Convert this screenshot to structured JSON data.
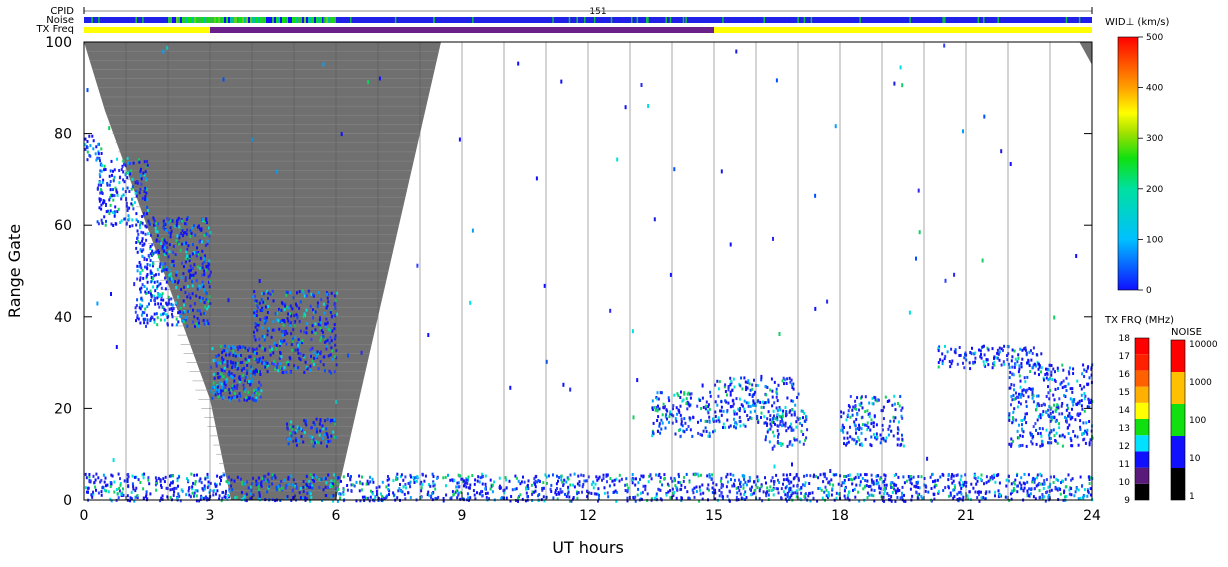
{
  "header": {
    "cpid_label": "CPID",
    "noise_label": "Noise",
    "txfreq_label": "TX Freq",
    "cpid_value": "151"
  },
  "chart_data": {
    "type": "heatmap",
    "title": "",
    "xlabel": "UT hours",
    "ylabel": "Range Gate",
    "xlim": [
      0,
      24
    ],
    "ylim": [
      0,
      100
    ],
    "x_ticks": [
      "0",
      "3",
      "6",
      "9",
      "12",
      "15",
      "18",
      "21",
      "24"
    ],
    "y_ticks": [
      "0",
      "20",
      "40",
      "60",
      "80",
      "100"
    ],
    "ground_scatter": {
      "color": "#707070",
      "boundary": [
        [
          0.0,
          100
        ],
        [
          0.5,
          85
        ],
        [
          3.0,
          22
        ],
        [
          3.5,
          0
        ],
        [
          6.0,
          0
        ],
        [
          8.5,
          100
        ]
      ],
      "end_wedge": [
        [
          24.0,
          100
        ],
        [
          23.7,
          100
        ],
        [
          24.0,
          95
        ]
      ]
    },
    "tx_freq_strip": {
      "segments": [
        {
          "from": 0,
          "to": 3,
          "color": "#ffff00"
        },
        {
          "from": 3,
          "to": 15,
          "color": "#6a1f8a"
        },
        {
          "from": 15,
          "to": 24,
          "color": "#ffff00"
        }
      ]
    },
    "noise_strip": {
      "base_color": "#2020e6",
      "green_band": [
        2.0,
        6.0
      ]
    },
    "echo_regions": [
      {
        "x": [
          0.0,
          24.0
        ],
        "y": [
          0,
          6
        ],
        "density": 0.55
      },
      {
        "x": [
          0.0,
          0.4
        ],
        "y": [
          74,
          80
        ],
        "density": 0.5
      },
      {
        "x": [
          0.3,
          1.5
        ],
        "y": [
          60,
          75
        ],
        "density": 0.5
      },
      {
        "x": [
          1.2,
          3.0
        ],
        "y": [
          38,
          62
        ],
        "density": 0.55
      },
      {
        "x": [
          3.0,
          4.2
        ],
        "y": [
          22,
          34
        ],
        "density": 0.7
      },
      {
        "x": [
          4.0,
          6.0
        ],
        "y": [
          28,
          46
        ],
        "density": 0.45
      },
      {
        "x": [
          4.8,
          6.0
        ],
        "y": [
          12,
          18
        ],
        "density": 0.5
      },
      {
        "x": [
          13.5,
          15.0
        ],
        "y": [
          14,
          24
        ],
        "density": 0.45
      },
      {
        "x": [
          15.0,
          17.0
        ],
        "y": [
          16,
          27
        ],
        "density": 0.45
      },
      {
        "x": [
          16.2,
          17.2
        ],
        "y": [
          12,
          20
        ],
        "density": 0.5
      },
      {
        "x": [
          18.0,
          19.5
        ],
        "y": [
          12,
          23
        ],
        "density": 0.45
      },
      {
        "x": [
          20.3,
          22.8
        ],
        "y": [
          29,
          34
        ],
        "density": 0.5
      },
      {
        "x": [
          22.0,
          24.0
        ],
        "y": [
          12,
          30
        ],
        "density": 0.45
      }
    ],
    "colorbars": {
      "width": {
        "label": "WID⊥ (km/s)",
        "ticks": [
          "0",
          "100",
          "200",
          "300",
          "400",
          "500"
        ]
      },
      "tx_freq": {
        "label": "TX FRQ (MHz)",
        "ticks": [
          "9",
          "10",
          "11",
          "12",
          "13",
          "14",
          "15",
          "16",
          "17",
          "18"
        ],
        "colors": [
          "#000000",
          "#5a1a7a",
          "#1010ff",
          "#00e0ff",
          "#10e010",
          "#ffff00",
          "#ffb000",
          "#ff6000",
          "#ff2000",
          "#ff0000"
        ]
      },
      "noise": {
        "label": "NOISE",
        "ticks": [
          "1",
          "10",
          "100",
          "1000",
          "10000"
        ],
        "colors": [
          "#000000",
          "#1010ff",
          "#10e010",
          "#ffc000",
          "#ff0000"
        ]
      }
    }
  }
}
